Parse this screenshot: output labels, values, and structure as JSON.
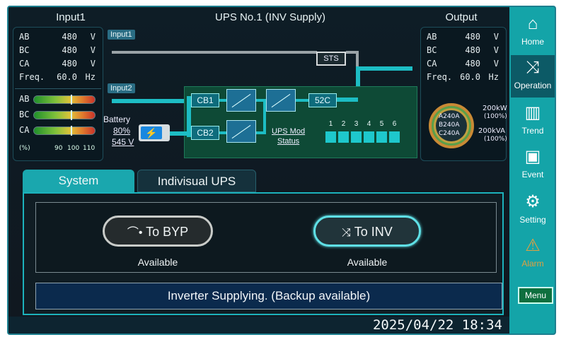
{
  "header": {
    "title": "UPS No.1  (INV Supply)"
  },
  "input1": {
    "title": "Input1",
    "rows": [
      {
        "label": "AB",
        "value": "480",
        "unit": "V"
      },
      {
        "label": "BC",
        "value": "480",
        "unit": "V"
      },
      {
        "label": "CA",
        "value": "480",
        "unit": "V"
      },
      {
        "label": "Freq.",
        "value": "60.0",
        "unit": "Hz"
      }
    ],
    "bars": [
      "AB",
      "BC",
      "CA"
    ],
    "scale_unit": "(%)",
    "scale_ticks": [
      "90",
      "100",
      "110"
    ]
  },
  "output": {
    "title": "Output",
    "rows": [
      {
        "label": "AB",
        "value": "480",
        "unit": "V"
      },
      {
        "label": "BC",
        "value": "480",
        "unit": "V"
      },
      {
        "label": "CA",
        "value": "480",
        "unit": "V"
      },
      {
        "label": "Freq.",
        "value": "60.0",
        "unit": "Hz"
      }
    ],
    "currents": [
      "A240A",
      "B240A",
      "C240A"
    ],
    "power_kw": "200kW",
    "power_kw_pct": "(100%)",
    "power_kva": "200kVA",
    "power_kva_pct": "(100%)"
  },
  "diagram": {
    "input1_tag": "Input1",
    "input2_tag": "Input2",
    "sts": "STS",
    "cb1": "CB1",
    "cb2": "CB2",
    "c52": "52C",
    "battery_label": "Battery",
    "battery_pct": "80%",
    "battery_volt": "545 V",
    "mod_status_line1": "UPS Mod",
    "mod_status_line2": "Status",
    "modules": [
      "1",
      "2",
      "3",
      "4",
      "5",
      "6"
    ]
  },
  "tabs": [
    {
      "label": "System"
    },
    {
      "label": "Indivisual UPS"
    }
  ],
  "controls": {
    "byp_label": "To BYP",
    "byp_state": "Available",
    "inv_label": "To INV",
    "inv_state": "Available"
  },
  "status": "Inverter Supplying. (Backup available)",
  "datetime": "2025/04/22  18:34",
  "nav": [
    {
      "label": "Home"
    },
    {
      "label": "Operation"
    },
    {
      "label": "Trend"
    },
    {
      "label": "Event"
    },
    {
      "label": "Setting"
    },
    {
      "label": "Alarm"
    }
  ],
  "menu_label": "Menu",
  "colors": {
    "accent": "#1dbdc4",
    "sidebar": "#14a4a8",
    "active_nav": "#0c5a66"
  }
}
